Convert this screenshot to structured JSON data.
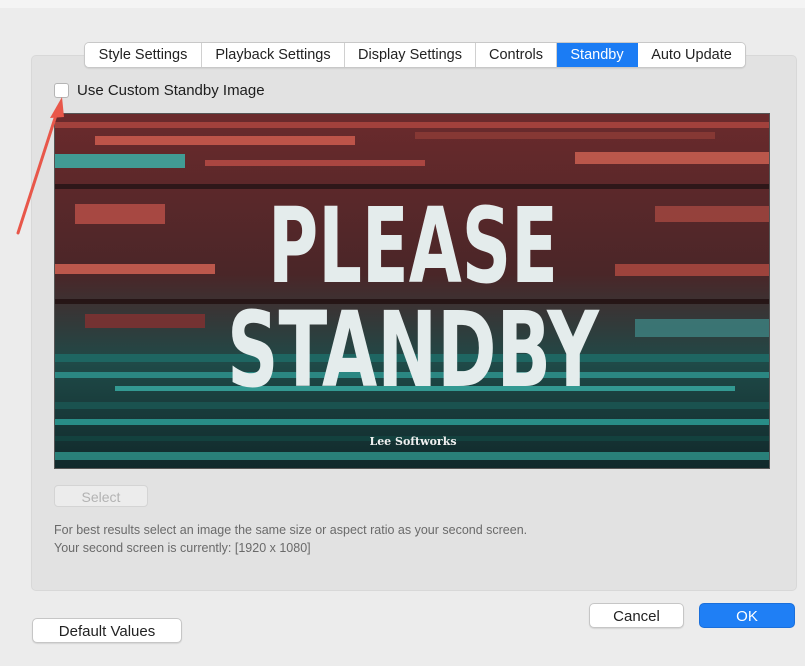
{
  "tabs": [
    {
      "label": "Style Settings",
      "active": false
    },
    {
      "label": "Playback Settings",
      "active": false
    },
    {
      "label": "Display Settings",
      "active": false
    },
    {
      "label": "Controls",
      "active": false
    },
    {
      "label": "Standby",
      "active": true
    },
    {
      "label": "Auto Update",
      "active": false
    }
  ],
  "custom_image": {
    "label": "Use Custom Standby Image",
    "checked": false
  },
  "preview": {
    "line1": "PLEASE",
    "line2": "STANDBY",
    "brand": "Lee Softworks"
  },
  "select_button": "Select",
  "hint": {
    "line1": "For best results select an image the same size or aspect ratio as your second screen.",
    "line2": "Your second screen is currently: [1920 x 1080]"
  },
  "buttons": {
    "cancel": "Cancel",
    "ok": "OK",
    "defaults": "Default Values"
  },
  "colors": {
    "accent": "#1b7cf4",
    "annotation_arrow": "#e8574a"
  },
  "icons": {
    "annotation": "arrow-annotation-icon"
  }
}
